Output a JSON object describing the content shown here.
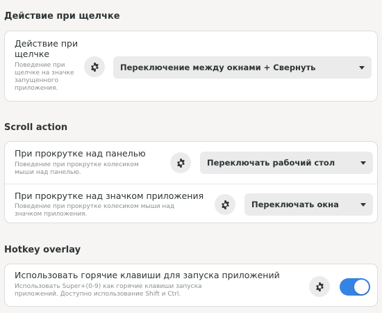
{
  "sections": [
    {
      "title": "Действие при щелчке",
      "rows": [
        {
          "title": "Действие при щелчке",
          "subtitle": "Поведение при щелчке на значке запущенного приложения.",
          "icon": "gear-icon",
          "control": "dropdown",
          "value": "Переключение между окнами + Свернуть"
        }
      ]
    },
    {
      "title": "Scroll action",
      "rows": [
        {
          "title": "При прокрутке над панелью",
          "subtitle": "Поведение при прокрутке колесиком мыши над панелью.",
          "icon": "gear-icon",
          "control": "dropdown",
          "value": "Переключать рабочий стол"
        },
        {
          "title": "При прокрутке над значком приложения",
          "subtitle": "Поведение при прокрутке колесиком мыши над значком приложения.",
          "icon": "gear-icon",
          "control": "dropdown",
          "value": "Переключать окна"
        }
      ]
    },
    {
      "title": "Hotkey overlay",
      "rows": [
        {
          "title": "Использовать горячие клавиши для запуска приложений",
          "subtitle": "Использовать Super+(0-9) как горячие клавиши запуска приложений. Доступно использование Shift и Ctrl.",
          "icon": "gear-icon",
          "control": "toggle",
          "value": true
        }
      ]
    }
  ],
  "colors": {
    "accent": "#3584e4",
    "background": "#f6f5f4",
    "card": "#ffffff",
    "control": "#ebebeb"
  }
}
